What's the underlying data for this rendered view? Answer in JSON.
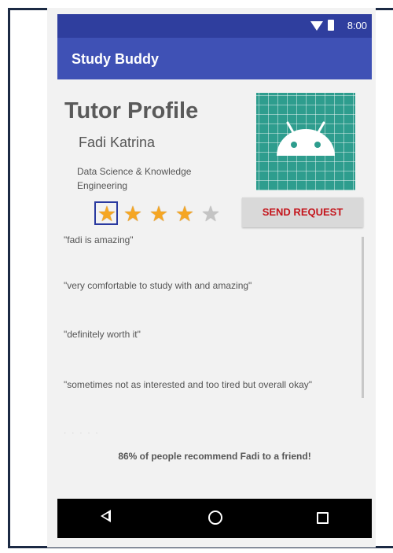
{
  "status_bar": {
    "time": "8:00"
  },
  "app_bar": {
    "title": "Study Buddy"
  },
  "profile": {
    "heading": "Tutor Profile",
    "name": "Fadi Katrina",
    "department": "Data Science & Knowledge Engineering",
    "avatar_icon": "android-robot-icon"
  },
  "rating": {
    "value": 4,
    "max": 5,
    "on_color": "#f5a623",
    "off_color": "#c4c4c4"
  },
  "send_request": {
    "label": "SEND REQUEST",
    "color": "#c4151c"
  },
  "reviews": [
    "\"fadi is amazing\"",
    "\"very comfortable to study with and amazing\"",
    "\"definitely worth it\"",
    "\"sometimes not as interested and too tired but overall okay\""
  ],
  "recommend_text": "86% of people recommend Fadi to a friend!",
  "colors": {
    "status_bar": "#2f3e9e",
    "app_bar": "#3f51b5",
    "avatar_bg": "#2e9d8e"
  },
  "nav_bar": {
    "icons": [
      "back-icon",
      "home-icon",
      "recents-icon"
    ]
  }
}
